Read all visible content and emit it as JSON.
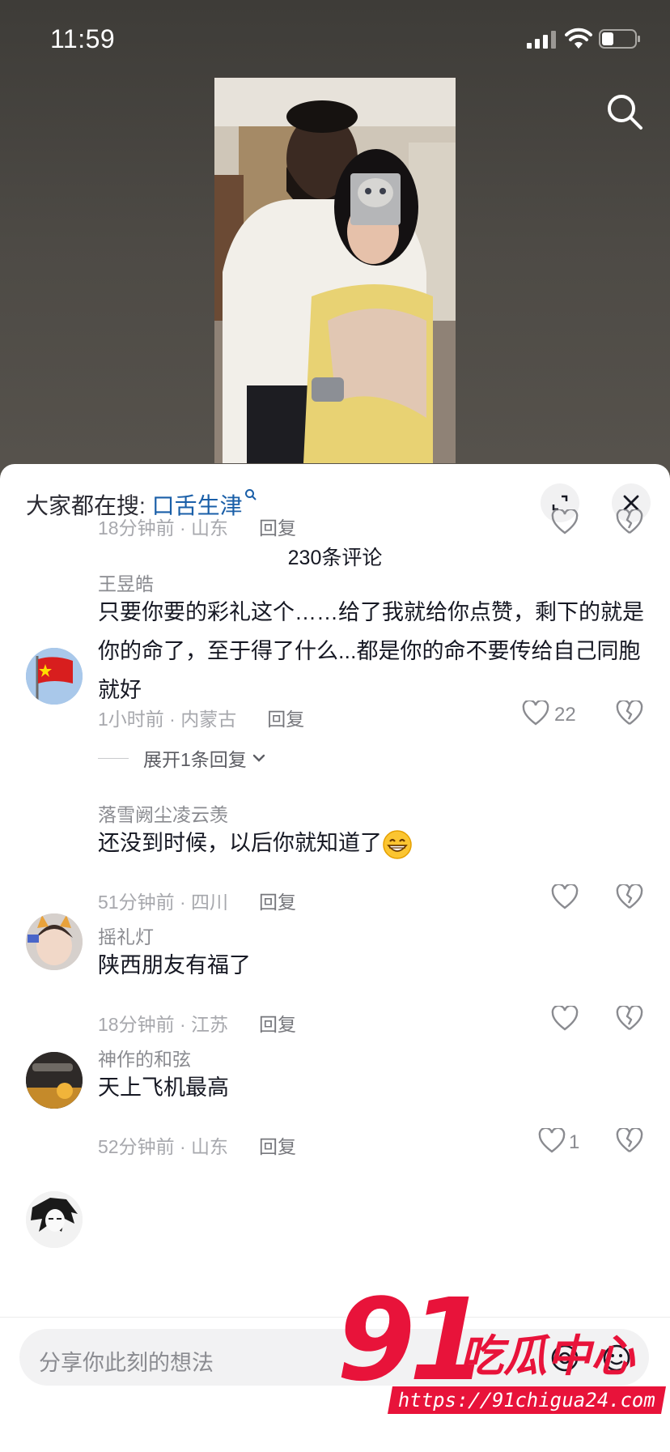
{
  "status_bar": {
    "time": "11:59"
  },
  "hot_search": {
    "prefix": "大家都在搜:",
    "keyword": "口舌生津"
  },
  "comment_count": "230条评论",
  "partial_comment": {
    "meta": "18分钟前 · 山东",
    "reply": "回复"
  },
  "comments": [
    {
      "username": "王昱皓",
      "text": "只要你要的彩礼这个……给了我就给你点赞，剩下的就是你的命了，至于得了什么...都是你的命不要传给自己同胞就好",
      "meta": "1小时前 · 内蒙古",
      "reply": "回复",
      "likes": "22",
      "expand_replies": "展开1条回复"
    },
    {
      "username": "落雪阙尘凌云羡",
      "text": "还没到时候，以后你就知道了",
      "emoji": "grinning-face-emoji",
      "meta": "51分钟前 · 四川",
      "reply": "回复",
      "likes": ""
    },
    {
      "username": "摇礼灯",
      "text": "陕西朋友有福了",
      "meta": "18分钟前 · 江苏",
      "reply": "回复",
      "likes": ""
    },
    {
      "username": "神作的和弦",
      "text": "天上飞机最高",
      "meta": "52分钟前 · 山东",
      "reply": "回复",
      "likes": "1"
    }
  ],
  "input": {
    "placeholder": "分享你此刻的想法"
  },
  "watermark": {
    "number": "91",
    "title": "吃瓜中心",
    "url": "https://91chigua24.com"
  },
  "colors": {
    "keyword": "#1a5fa8",
    "watermark": "#e8133a",
    "meta": "#a7a8ad"
  }
}
